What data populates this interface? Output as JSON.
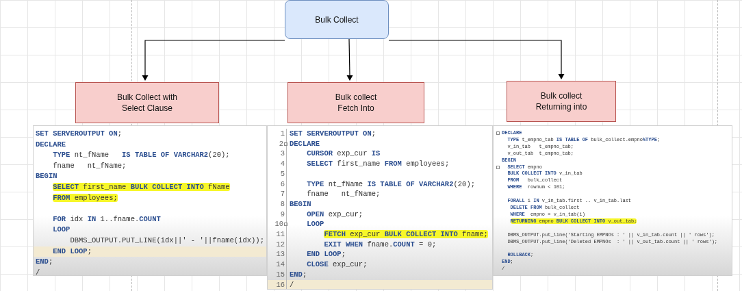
{
  "root_node": {
    "label": "Bulk Collect"
  },
  "child_nodes": [
    {
      "lines": [
        "Bulk Collect with",
        "Select Clause"
      ]
    },
    {
      "lines": [
        "Bulk collect",
        "Fetch Into"
      ]
    },
    {
      "lines": [
        "Bulk collect",
        "Returning into"
      ]
    }
  ],
  "code_panels": [
    {
      "lines": [
        {
          "kind": "code",
          "text": "**SET SERVEROUTPUT ON**;",
          "highlighted": false,
          "current": false
        },
        {
          "kind": "code",
          "text": "**DECLARE**",
          "highlighted": false,
          "current": false
        },
        {
          "kind": "code",
          "text": "    **TYPE** nt_fName   **IS TABLE OF VARCHAR2**(20);",
          "highlighted": false,
          "current": false
        },
        {
          "kind": "code",
          "text": "    fname   nt_fName;",
          "highlighted": false,
          "current": false
        },
        {
          "kind": "code",
          "text": "**BEGIN**",
          "highlighted": false,
          "current": false
        },
        {
          "kind": "code",
          "text": "    **SELECT** first_name **BULK COLLECT INTO** fName",
          "highlighted": true,
          "current": false
        },
        {
          "kind": "code",
          "text": "    **FROM** employees;",
          "highlighted": true,
          "current": false
        },
        {
          "kind": "blank",
          "current": false
        },
        {
          "kind": "code",
          "text": "    **FOR** idx **IN** 1..fname.**COUNT**",
          "highlighted": false,
          "current": false
        },
        {
          "kind": "code",
          "text": "    **LOOP**",
          "highlighted": false,
          "current": false
        },
        {
          "kind": "code",
          "text": "        DBMS_OUTPUT.PUT_LINE(idx||' - '||fname(idx));",
          "highlighted": false,
          "current": false
        },
        {
          "kind": "code",
          "text": "    **END LOOP**;",
          "highlighted": false,
          "current": true
        },
        {
          "kind": "code",
          "text": "**END**;",
          "highlighted": false,
          "current": false
        },
        {
          "kind": "code",
          "text": "/",
          "highlighted": false,
          "current": false
        }
      ]
    },
    {
      "lines": [
        {
          "kind": "code",
          "number": "1",
          "text": "**SET SERVEROUTPUT ON**;",
          "fold": false,
          "highlighted": false,
          "current": false
        },
        {
          "kind": "code",
          "number": "2",
          "text": "**DECLARE**",
          "fold": true,
          "highlighted": false,
          "current": false
        },
        {
          "kind": "code",
          "number": "3",
          "text": "    **CURSOR** exp_cur **IS**",
          "fold": false,
          "highlighted": false,
          "current": false
        },
        {
          "kind": "code",
          "number": "4",
          "text": "    **SELECT** first_name **FROM** employees;",
          "fold": false,
          "highlighted": false,
          "current": false
        },
        {
          "kind": "blank",
          "number": "5",
          "fold": false,
          "current": false
        },
        {
          "kind": "code",
          "number": "6",
          "text": "    **TYPE** nt_fName **IS TABLE OF VARCHAR2**(20);",
          "fold": false,
          "highlighted": false,
          "current": false
        },
        {
          "kind": "code",
          "number": "7",
          "text": "    fname   nt_fName;",
          "fold": false,
          "highlighted": false,
          "current": false
        },
        {
          "kind": "code",
          "number": "8",
          "text": "**BEGIN**",
          "fold": false,
          "highlighted": false,
          "current": false
        },
        {
          "kind": "code",
          "number": "9",
          "text": "    **OPEN** exp_cur;",
          "fold": false,
          "highlighted": false,
          "current": false
        },
        {
          "kind": "code",
          "number": "10",
          "text": "    **LOOP**",
          "fold": true,
          "highlighted": false,
          "current": false
        },
        {
          "kind": "code",
          "number": "11",
          "text": "        **FETCH** exp_cur **BULK COLLECT INTO** fname;",
          "fold": false,
          "highlighted": true,
          "current": false
        },
        {
          "kind": "code",
          "number": "12",
          "text": "        **EXIT WHEN** fname.**COUNT** = 0;",
          "fold": false,
          "highlighted": false,
          "current": false
        },
        {
          "kind": "code",
          "number": "13",
          "text": "    **END LOOP**;",
          "fold": false,
          "highlighted": false,
          "current": false
        },
        {
          "kind": "code",
          "number": "14",
          "text": "    **CLOSE** exp_cur;",
          "fold": false,
          "highlighted": false,
          "current": false
        },
        {
          "kind": "code",
          "number": "15",
          "text": "**END**;",
          "fold": false,
          "highlighted": false,
          "current": false
        },
        {
          "kind": "code",
          "number": "16",
          "text": "/",
          "fold": false,
          "highlighted": false,
          "current": true
        }
      ]
    },
    {
      "lines": [
        {
          "kind": "code",
          "text": "**DECLARE**",
          "fold": true,
          "highlighted": false,
          "current": false
        },
        {
          "kind": "code",
          "text": "  **TYPE** t_empno_tab **IS TABLE OF** bulk_collect.empno**%TYPE**;",
          "fold": false,
          "highlighted": false,
          "current": false
        },
        {
          "kind": "code",
          "text": "  v_in_tab   t_empno_tab;",
          "fold": false,
          "highlighted": false,
          "current": false
        },
        {
          "kind": "code",
          "text": "  v_out_tab  t_empno_tab;",
          "fold": false,
          "highlighted": false,
          "current": false
        },
        {
          "kind": "code",
          "text": "**BEGIN**",
          "fold": false,
          "highlighted": false,
          "current": false
        },
        {
          "kind": "code",
          "text": "  **SELECT** empno",
          "fold": true,
          "highlighted": false,
          "current": false
        },
        {
          "kind": "code",
          "text": "  **BULK COLLECT INTO** v_in_tab",
          "fold": false,
          "highlighted": false,
          "current": false
        },
        {
          "kind": "code",
          "text": "  **FROM**   bulk_collect",
          "fold": false,
          "highlighted": false,
          "current": false
        },
        {
          "kind": "code",
          "text": "  **WHERE**  rownum < 101;",
          "fold": false,
          "highlighted": false,
          "current": false
        },
        {
          "kind": "blank",
          "fold": false,
          "current": false
        },
        {
          "kind": "code",
          "text": "  **FORALL** i **IN** v_in_tab.first .. v_in_tab.last",
          "fold": false,
          "highlighted": false,
          "current": false
        },
        {
          "kind": "code",
          "text": "   **DELETE FROM** bulk_collect",
          "fold": false,
          "highlighted": false,
          "current": false
        },
        {
          "kind": "code",
          "text": "   **WHERE**  empno = v_in_tab(i)",
          "fold": false,
          "highlighted": false,
          "current": false
        },
        {
          "kind": "code",
          "text": "   **RETURNING** empno **BULK COLLECT INTO** v_out_tab;",
          "fold": false,
          "highlighted": true,
          "current": false
        },
        {
          "kind": "blank",
          "fold": false,
          "current": false
        },
        {
          "kind": "code",
          "text": "  DBMS_OUTPUT.put_line('Starting EMPNOs : ' || v_in_tab.count || ' rows');",
          "fold": false,
          "highlighted": false,
          "current": false
        },
        {
          "kind": "code",
          "text": "  DBMS_OUTPUT.put_line('Deleted EMPNOs  : ' || v_out_tab.count || ' rows');",
          "fold": false,
          "highlighted": false,
          "current": false
        },
        {
          "kind": "blank",
          "fold": false,
          "current": false
        },
        {
          "kind": "code",
          "text": "  **ROLLBACK**;",
          "fold": false,
          "highlighted": false,
          "current": false
        },
        {
          "kind": "code",
          "text": "**END**;",
          "fold": false,
          "highlighted": false,
          "current": false
        },
        {
          "kind": "code",
          "text": "/",
          "fold": false,
          "highlighted": false,
          "current": false
        }
      ]
    }
  ]
}
